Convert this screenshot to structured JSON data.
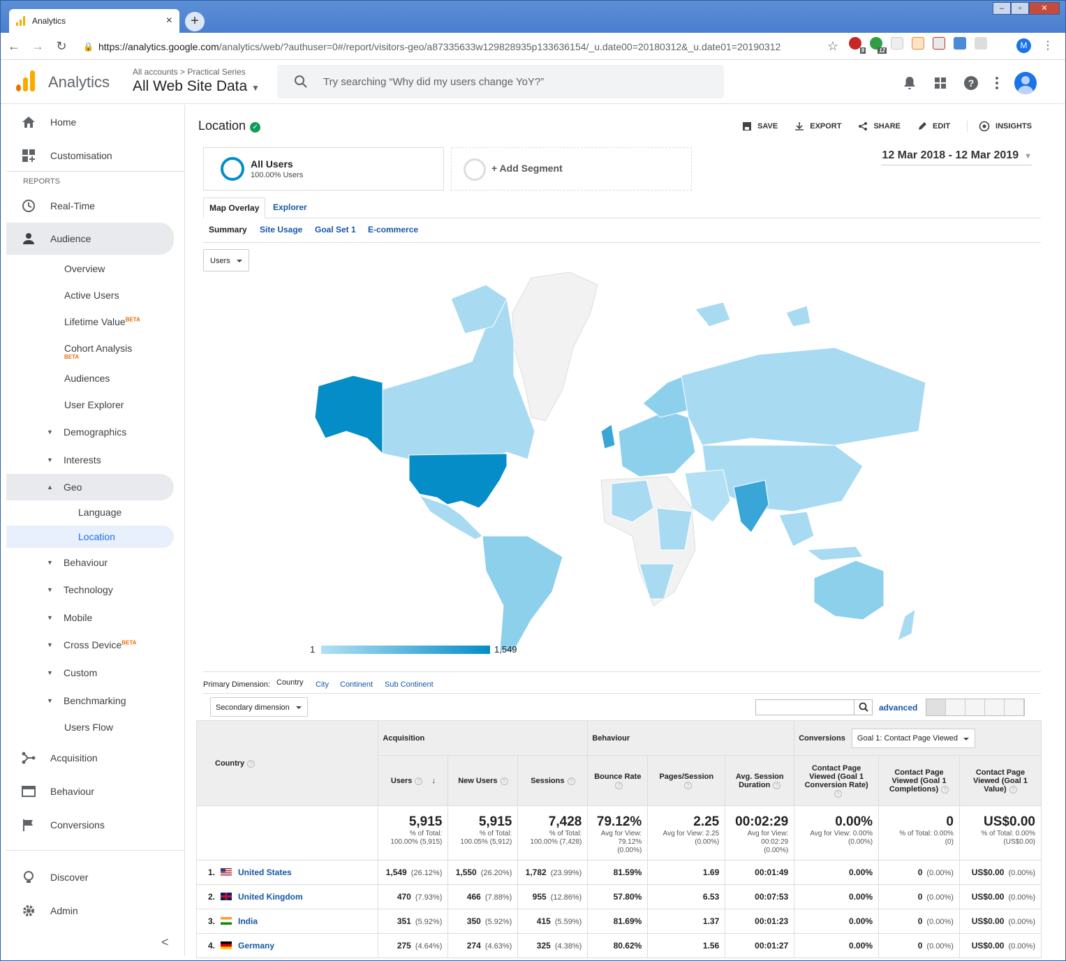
{
  "browser": {
    "tab_title": "Analytics",
    "url_host": "https://analytics.google.com",
    "url_path": "/analytics/web/?authuser=0#/report/visitors-geo/a87335633w129828935p133636154/_u.date00=20180312&_u.date01=20190312",
    "profile_initial": "M",
    "ext_badges": [
      "9",
      "12"
    ]
  },
  "header": {
    "app_name": "Analytics",
    "breadcrumb_accounts": "All accounts",
    "breadcrumb_sep": ">",
    "breadcrumb_series": "Practical Series",
    "property": "All Web Site Data",
    "search_placeholder": "Try searching “Why did my users change YoY?”"
  },
  "sidebar": {
    "home": "Home",
    "customisation": "Customisation",
    "reports_heading": "REPORTS",
    "realtime": "Real-Time",
    "audience": "Audience",
    "audience_items": [
      {
        "label": "Overview"
      },
      {
        "label": "Active Users"
      },
      {
        "label": "Lifetime Value",
        "badge": "BETA"
      },
      {
        "label": "Cohort Analysis",
        "badge": "BETA"
      },
      {
        "label": "Audiences"
      },
      {
        "label": "User Explorer"
      },
      {
        "label": "Demographics"
      },
      {
        "label": "Interests"
      },
      {
        "label": "Geo"
      },
      {
        "label": "Language"
      },
      {
        "label": "Location"
      },
      {
        "label": "Behaviour"
      },
      {
        "label": "Technology"
      },
      {
        "label": "Mobile"
      },
      {
        "label": "Cross Device",
        "badge": "BETA"
      },
      {
        "label": "Custom"
      },
      {
        "label": "Benchmarking"
      },
      {
        "label": "Users Flow"
      }
    ],
    "acquisition": "Acquisition",
    "behaviour": "Behaviour",
    "conversions": "Conversions",
    "discover": "Discover",
    "admin": "Admin",
    "collapse": "<"
  },
  "report": {
    "title": "Location",
    "actions": [
      "SAVE",
      "EXPORT",
      "SHARE",
      "EDIT",
      "INSIGHTS"
    ],
    "segment_name": "All Users",
    "segment_sub": "100.00% Users",
    "add_segment": "+ Add Segment",
    "date_range": "12 Mar 2018 - 12 Mar 2019",
    "tabs": [
      "Map Overlay",
      "Explorer"
    ],
    "subtabs": [
      "Summary",
      "Site Usage",
      "Goal Set 1",
      "E-commerce"
    ],
    "metric_select": "Users",
    "legend_min": "1",
    "legend_max": "1,549",
    "primary_dimension_label": "Primary Dimension:",
    "dimensions": [
      "Country",
      "City",
      "Continent",
      "Sub Continent"
    ],
    "secondary_dimension": "Secondary dimension",
    "advanced": "advanced"
  },
  "table": {
    "country_header": "Country",
    "groups": {
      "acquisition": "Acquisition",
      "behaviour": "Behaviour",
      "conversions": "Conversions",
      "goal_select": "Goal 1: Contact Page Viewed"
    },
    "columns": [
      "Users",
      "New Users",
      "Sessions",
      "Bounce Rate",
      "Pages/Session",
      "Avg. Session Duration",
      "Contact Page Viewed (Goal 1 Conversion Rate)",
      "Contact Page Viewed (Goal 1 Completions)",
      "Contact Page Viewed (Goal 1 Value)"
    ],
    "totals": [
      {
        "big": "5,915",
        "l1": "% of Total:",
        "l2": "100.00% (5,915)"
      },
      {
        "big": "5,915",
        "l1": "% of Total:",
        "l2": "100.05% (5,912)"
      },
      {
        "big": "7,428",
        "l1": "% of Total:",
        "l2": "100.00% (7,428)"
      },
      {
        "big": "79.12%",
        "l1": "Avg for View:",
        "l2": "79.12%",
        "l3": "(0.00%)"
      },
      {
        "big": "2.25",
        "l1": "Avg for View: 2.25",
        "l2": "(0.00%)"
      },
      {
        "big": "00:02:29",
        "l1": "Avg for View:",
        "l2": "00:02:29",
        "l3": "(0.00%)"
      },
      {
        "big": "0.00%",
        "l1": "Avg for View: 0.00%",
        "l2": "(0.00%)"
      },
      {
        "big": "0",
        "l1": "% of Total: 0.00%",
        "l2": "(0)"
      },
      {
        "big": "US$0.00",
        "l1": "% of Total: 0.00%",
        "l2": "(US$0.00)"
      }
    ],
    "rows": [
      {
        "n": "1.",
        "country": "United States",
        "flag": "us",
        "users": "1,549",
        "users_p": "(26.12%)",
        "new": "1,550",
        "new_p": "(26.20%)",
        "sessions": "1,782",
        "sessions_p": "(23.99%)",
        "bounce": "81.59%",
        "pps": "1.69",
        "dur": "00:01:49",
        "cr": "0.00%",
        "comp": "0",
        "comp_p": "(0.00%)",
        "val": "US$0.00",
        "val_p": "(0.00%)"
      },
      {
        "n": "2.",
        "country": "United Kingdom",
        "flag": "uk",
        "users": "470",
        "users_p": "(7.93%)",
        "new": "466",
        "new_p": "(7.88%)",
        "sessions": "955",
        "sessions_p": "(12.86%)",
        "bounce": "57.80%",
        "pps": "6.53",
        "dur": "00:07:53",
        "cr": "0.00%",
        "comp": "0",
        "comp_p": "(0.00%)",
        "val": "US$0.00",
        "val_p": "(0.00%)"
      },
      {
        "n": "3.",
        "country": "India",
        "flag": "in",
        "users": "351",
        "users_p": "(5.92%)",
        "new": "350",
        "new_p": "(5.92%)",
        "sessions": "415",
        "sessions_p": "(5.59%)",
        "bounce": "81.69%",
        "pps": "1.37",
        "dur": "00:01:23",
        "cr": "0.00%",
        "comp": "0",
        "comp_p": "(0.00%)",
        "val": "US$0.00",
        "val_p": "(0.00%)"
      },
      {
        "n": "4.",
        "country": "Germany",
        "flag": "de",
        "users": "275",
        "users_p": "(4.64%)",
        "new": "274",
        "new_p": "(4.63%)",
        "sessions": "325",
        "sessions_p": "(4.38%)",
        "bounce": "80.62%",
        "pps": "1.56",
        "dur": "00:01:27",
        "cr": "0.00%",
        "comp": "0",
        "comp_p": "(0.00%)",
        "val": "US$0.00",
        "val_p": "(0.00%)"
      }
    ]
  },
  "colors": {
    "accent": "#058dc7",
    "link": "#1558a6",
    "map_light": "#a8dbf1",
    "map_none": "#f2f2f2",
    "brand_orange": "#f9ab00",
    "brand_dark": "#e37400"
  }
}
